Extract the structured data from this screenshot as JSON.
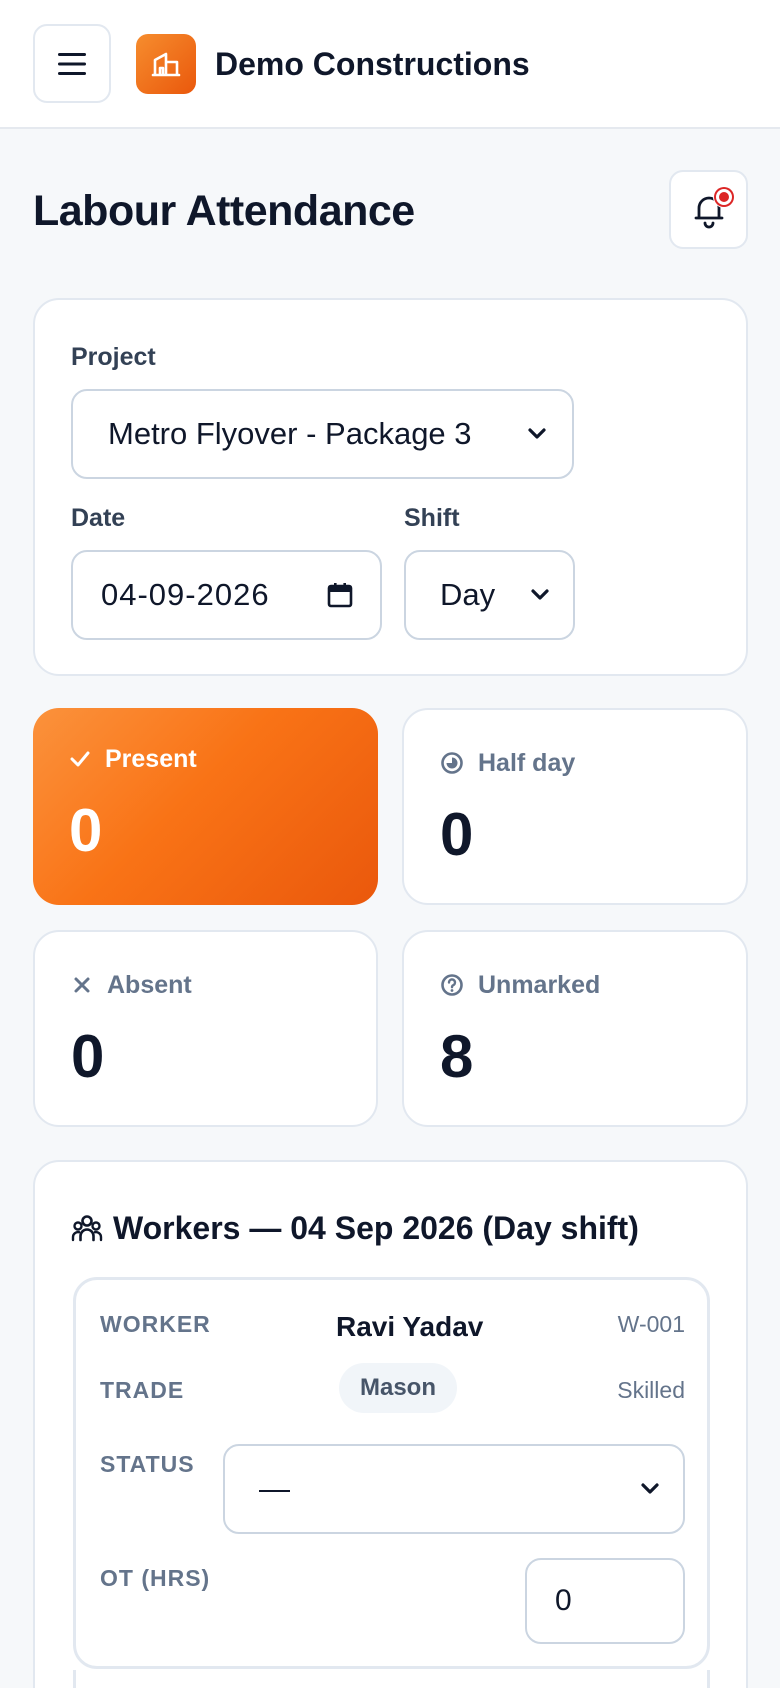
{
  "header": {
    "company_name": "Demo Constructions",
    "menu_icon": "hamburger-icon",
    "logo_icon": "building-icon"
  },
  "page": {
    "title": "Labour Attendance",
    "notification_icon": "bell-icon"
  },
  "filters": {
    "project_label": "Project",
    "project_value": "Metro Flyover - Package 3",
    "date_label": "Date",
    "date_value": "04-09-2026",
    "shift_label": "Shift",
    "shift_value": "Day"
  },
  "stats": {
    "present": {
      "label": "Present",
      "value": "0",
      "icon": "check-icon"
    },
    "half_day": {
      "label": "Half day",
      "value": "0",
      "icon": "half-circle-icon"
    },
    "absent": {
      "label": "Absent",
      "value": "0",
      "icon": "x-icon"
    },
    "unmarked": {
      "label": "Unmarked",
      "value": "8",
      "icon": "question-circle-icon"
    }
  },
  "workers": {
    "title": "Workers — 04 Sep 2026 (Day shift)",
    "icon": "users-icon",
    "items": [
      {
        "worker_key": "WORKER",
        "name": "Ravi Yadav",
        "id": "W-001",
        "trade_key": "TRADE",
        "trade": "Mason",
        "skill": "Skilled",
        "status_key": "STATUS",
        "status_value": "—",
        "ot_key": "OT (HRS)",
        "ot_value": "0"
      }
    ]
  },
  "colors": {
    "accent": "#f97316",
    "accent_dark": "#ea580c",
    "notification_dot": "#dc2626",
    "text": "#0f172a",
    "muted": "#64748b"
  }
}
